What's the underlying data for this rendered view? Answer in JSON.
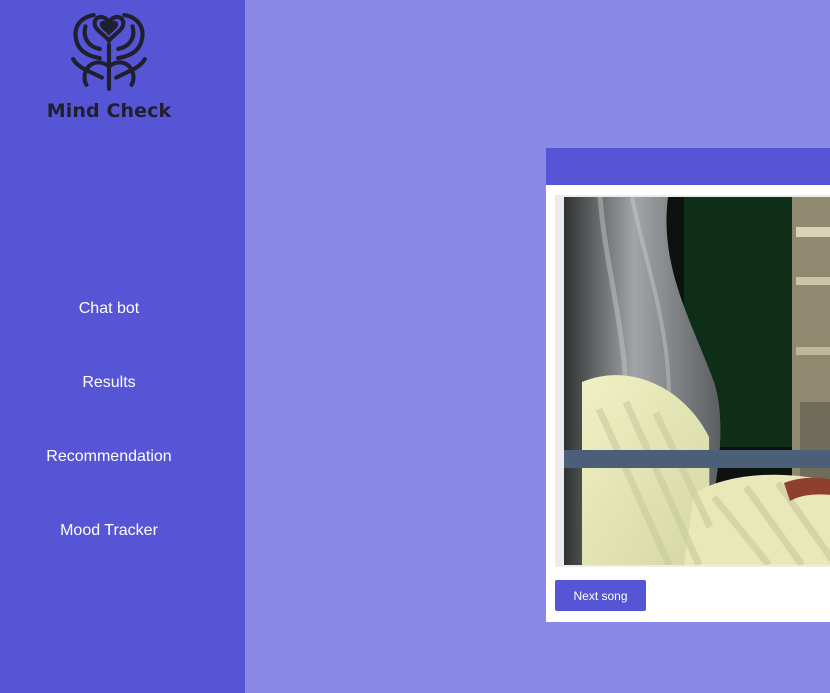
{
  "app": {
    "brand_name": "Mind Check",
    "logo_icon": "heart-tree-icon"
  },
  "colors": {
    "background": "#8a8ae6",
    "sidebar": "#5555d6",
    "accent": "#5555d6",
    "card": "#ffffff",
    "nav_text": "#ffffff",
    "logo": "#1f1f2e"
  },
  "sidebar": {
    "items": [
      {
        "label": "Chat bot"
      },
      {
        "label": "Results"
      },
      {
        "label": "Recommendation"
      },
      {
        "label": "Mood Tracker"
      }
    ]
  },
  "player": {
    "next_label": "Next song"
  }
}
